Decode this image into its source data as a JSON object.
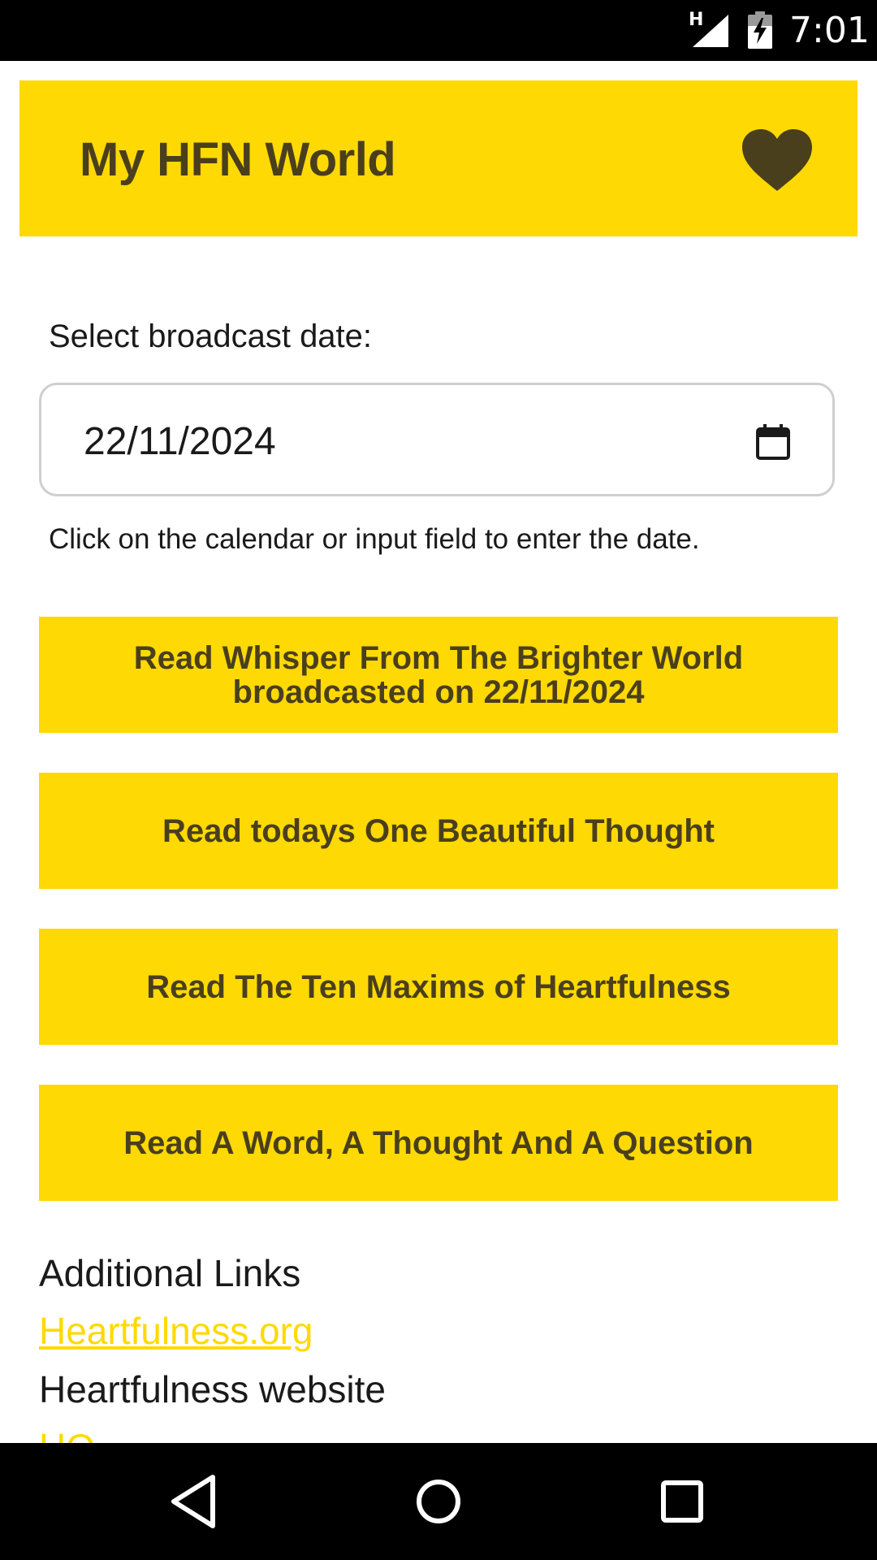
{
  "status_bar": {
    "network_type": "H",
    "time": "7:01",
    "icons": [
      "signal-icon",
      "battery-charging-icon"
    ]
  },
  "header": {
    "title": "My HFN World",
    "icon": "heart-icon",
    "color": "#FFD903",
    "text_color": "#4a3f1c"
  },
  "date_section": {
    "label": "Select broadcast date:",
    "input_value": "22/11/2024",
    "icon": "calendar-icon",
    "help_text": "Click on the calendar or input field to enter the date."
  },
  "buttons": [
    {
      "label": "Read Whisper From The Brighter World broadcasted on 22/11/2024"
    },
    {
      "label": "Read todays One Beautiful Thought"
    },
    {
      "label": "Read The Ten Maxims of Heartfulness"
    },
    {
      "label": "Read A Word, A Thought And A Question"
    }
  ],
  "additional_links": {
    "heading": "Additional Links",
    "links": [
      {
        "text": "Heartfulness.org",
        "description": "Heartfulness website"
      },
      {
        "text": "HQ"
      }
    ]
  },
  "nav_bar": {
    "icons": [
      "back-icon",
      "home-icon",
      "recents-icon"
    ]
  }
}
